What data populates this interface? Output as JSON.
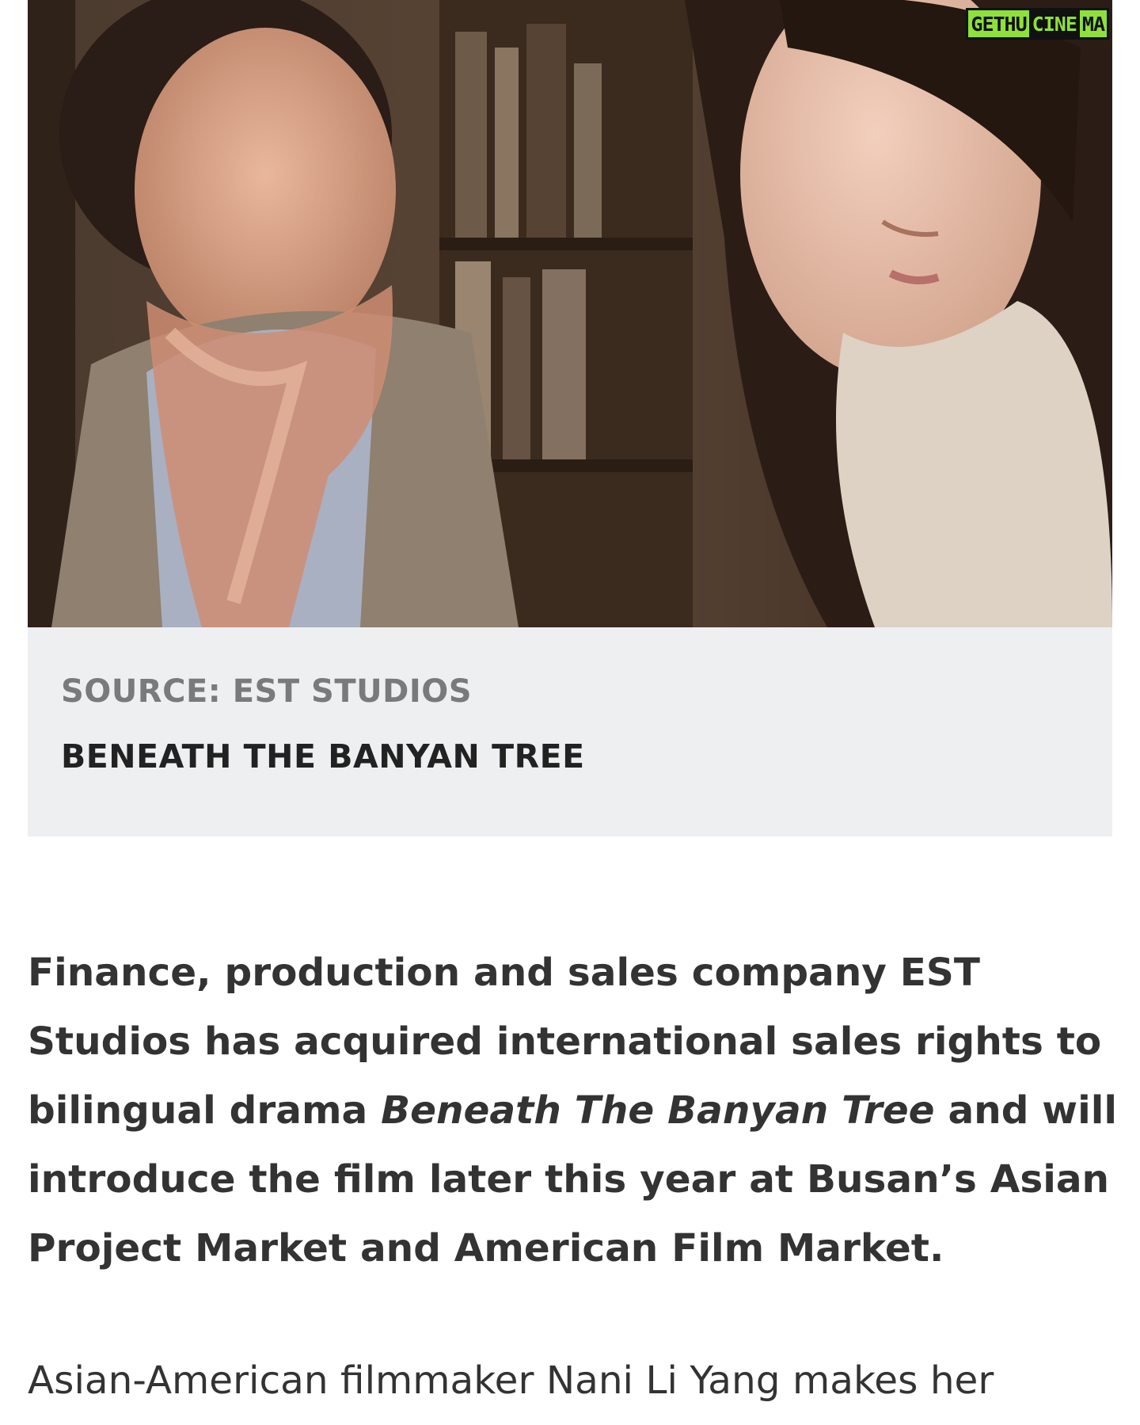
{
  "watermark": {
    "part1": "GETHU",
    "part2": "CINE",
    "part3": "MA"
  },
  "photo": {
    "alt": "Still from Beneath The Banyan Tree"
  },
  "caption": {
    "source": "SOURCE: EST STUDIOS",
    "title": "BENEATH THE BANYAN TREE"
  },
  "article": {
    "lead_before": "Finance, production and sales company EST Studios has acquired international sales rights to bilingual drama ",
    "lead_film": "Beneath The Banyan Tree",
    "lead_after": " and will introduce the film later this year at Busan’s Asian Project Market and American Film Market.",
    "paragraph_start": "Asian-American filmmaker Nani Li Yang makes her"
  },
  "colors": {
    "caption_bg": "#eeeff1",
    "source_text": "#7a7a7a",
    "title_text": "#222222",
    "body_text": "#333333",
    "watermark_green": "#8fe03a"
  }
}
